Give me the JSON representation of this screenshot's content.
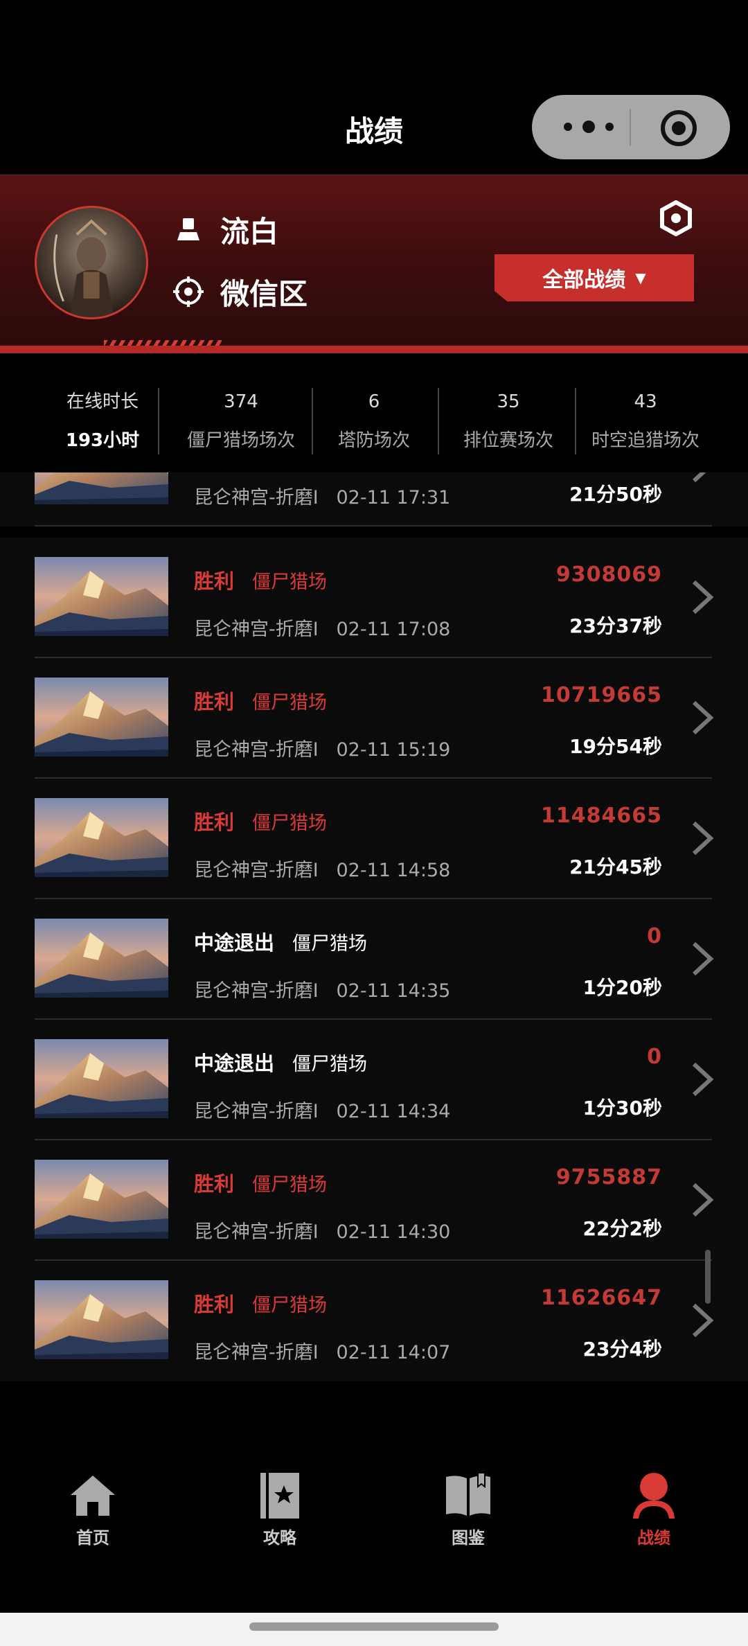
{
  "header": {
    "title": "战绩"
  },
  "profile": {
    "name": "流白",
    "region": "微信区",
    "filter_label": "全部战绩",
    "filter_caret": "▼"
  },
  "stats": [
    {
      "top": "在线时长",
      "bottom": "193小时"
    },
    {
      "top": "374",
      "bottom": "僵尸猎场场次"
    },
    {
      "top": "6",
      "bottom": "塔防场次"
    },
    {
      "top": "35",
      "bottom": "排位赛场次"
    },
    {
      "top": "43",
      "bottom": "时空追猎场次"
    }
  ],
  "records": [
    {
      "result": "",
      "mode": "",
      "map": "昆仑神宫-折磨I",
      "time": "02-11 17:31",
      "score": "",
      "duration": "21分50秒"
    },
    {
      "result": "胜利",
      "mode": "僵尸猎场",
      "map": "昆仑神宫-折磨I",
      "time": "02-11 17:08",
      "score": "9308069",
      "duration": "23分37秒"
    },
    {
      "result": "胜利",
      "mode": "僵尸猎场",
      "map": "昆仑神宫-折磨I",
      "time": "02-11 15:19",
      "score": "10719665",
      "duration": "19分54秒"
    },
    {
      "result": "胜利",
      "mode": "僵尸猎场",
      "map": "昆仑神宫-折磨I",
      "time": "02-11 14:58",
      "score": "11484665",
      "duration": "21分45秒"
    },
    {
      "result": "中途退出",
      "mode": "僵尸猎场",
      "map": "昆仑神宫-折磨I",
      "time": "02-11 14:35",
      "score": "0",
      "duration": "1分20秒"
    },
    {
      "result": "中途退出",
      "mode": "僵尸猎场",
      "map": "昆仑神宫-折磨I",
      "time": "02-11 14:34",
      "score": "0",
      "duration": "1分30秒"
    },
    {
      "result": "胜利",
      "mode": "僵尸猎场",
      "map": "昆仑神宫-折磨I",
      "time": "02-11 14:30",
      "score": "9755887",
      "duration": "22分2秒"
    },
    {
      "result": "胜利",
      "mode": "僵尸猎场",
      "map": "昆仑神宫-折磨I",
      "time": "02-11 14:07",
      "score": "11626647",
      "duration": "23分4秒"
    }
  ],
  "tabs": [
    {
      "label": "首页",
      "icon": "home-icon"
    },
    {
      "label": "攻略",
      "icon": "guide-book-icon"
    },
    {
      "label": "图鉴",
      "icon": "open-book-icon"
    },
    {
      "label": "战绩",
      "icon": "user-icon"
    }
  ],
  "colors": {
    "accent_red": "#d93a36",
    "button_red": "#c62f2b",
    "profile_bg": "#4a1011"
  }
}
